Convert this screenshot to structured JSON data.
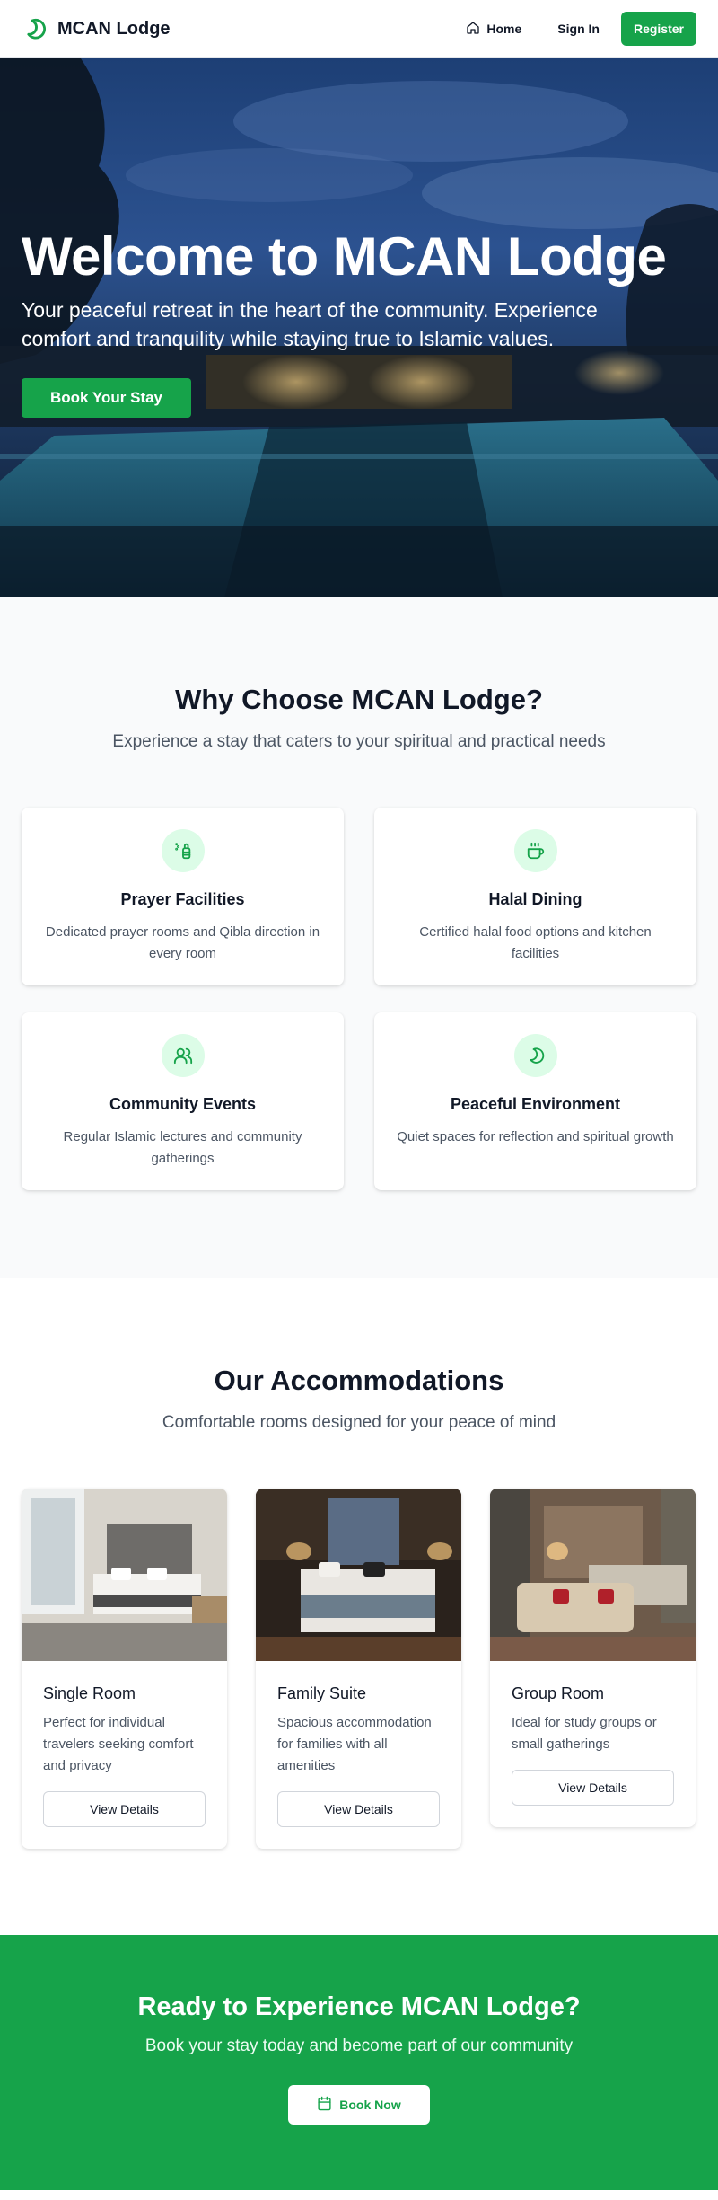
{
  "colors": {
    "accent": "#16a34a",
    "accent_light": "#dcfce7"
  },
  "nav": {
    "brand": "MCAN Lodge",
    "logo_icon": "crescent-moon-icon",
    "home_label": "Home",
    "home_icon": "home-icon",
    "signin_label": "Sign In",
    "register_label": "Register"
  },
  "hero": {
    "title": "Welcome to MCAN Lodge",
    "subtitle": "Your peaceful retreat in the heart of the community. Experience comfort and tranquility while staying true to Islamic values.",
    "cta_label": "Book Your Stay"
  },
  "features": {
    "title": "Why Choose MCAN Lodge?",
    "subtitle": "Experience a stay that caters to your spiritual and practical needs",
    "items": [
      {
        "icon": "prayer-beads-icon",
        "title": "Prayer Facilities",
        "description": "Dedicated prayer rooms and Qibla direction in every room"
      },
      {
        "icon": "coffee-cup-icon",
        "title": "Halal Dining",
        "description": "Certified halal food options and kitchen facilities"
      },
      {
        "icon": "users-icon",
        "title": "Community Events",
        "description": "Regular Islamic lectures and community gatherings"
      },
      {
        "icon": "moon-icon",
        "title": "Peaceful Environment",
        "description": "Quiet spaces for reflection and spiritual growth"
      }
    ]
  },
  "rooms": {
    "title": "Our Accommodations",
    "subtitle": "Comfortable rooms designed for your peace of mind",
    "items": [
      {
        "title": "Single Room",
        "description": "Perfect for individual travelers seeking comfort and privacy",
        "button": "View Details"
      },
      {
        "title": "Family Suite",
        "description": "Spacious accommodation for families with all amenities",
        "button": "View Details"
      },
      {
        "title": "Group Room",
        "description": "Ideal for study groups or small gatherings",
        "button": "View Details"
      }
    ]
  },
  "cta": {
    "title": "Ready to Experience MCAN Lodge?",
    "subtitle": "Book your stay today and become part of our community",
    "button": "Book Now",
    "button_icon": "calendar-icon"
  }
}
